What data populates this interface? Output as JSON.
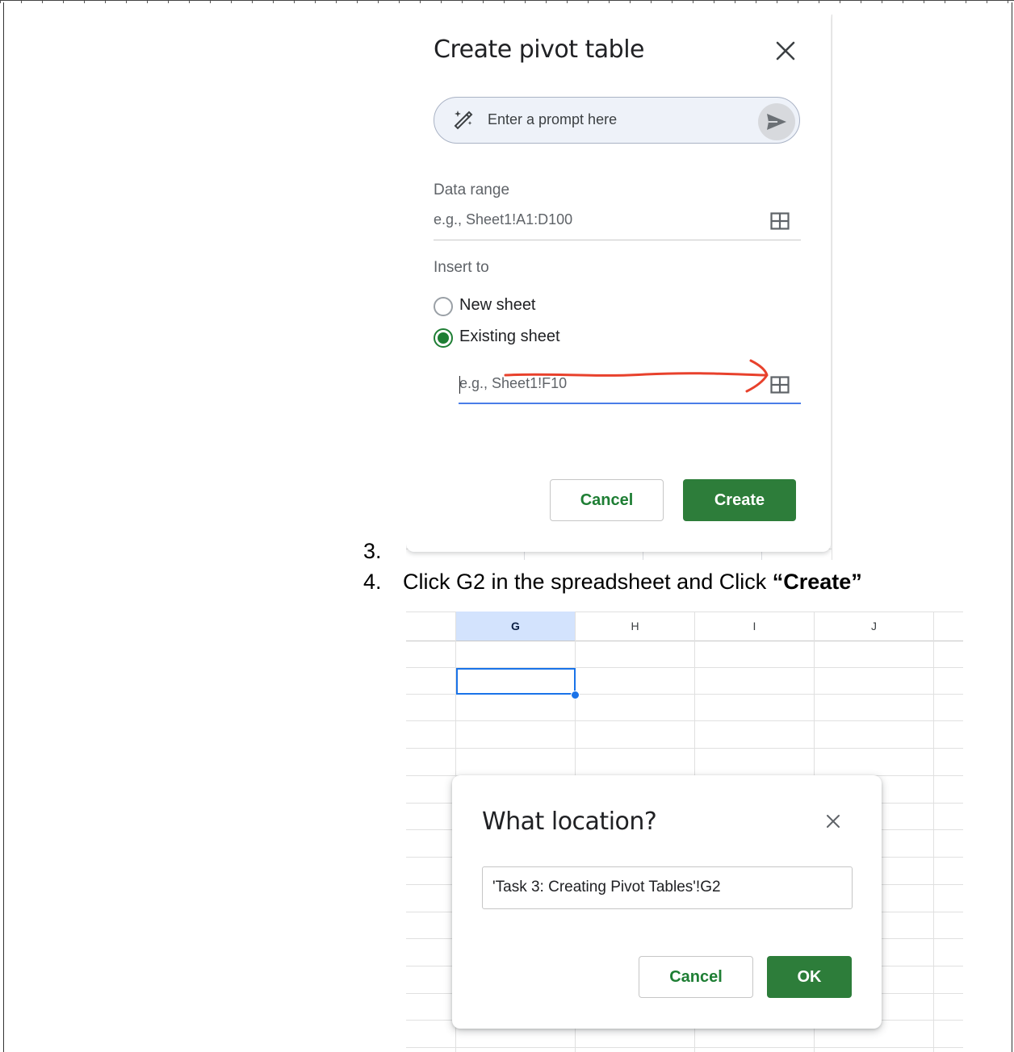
{
  "pivot_dialog": {
    "title": "Create pivot table",
    "prompt_placeholder": "Enter a prompt here",
    "data_range_label": "Data range",
    "data_range_placeholder": "e.g., Sheet1!A1:D100",
    "insert_to_label": "Insert to",
    "options": [
      {
        "label": "New sheet",
        "checked": false
      },
      {
        "label": "Existing sheet",
        "checked": true
      }
    ],
    "location_placeholder": "e.g., Sheet1!F10",
    "cancel_label": "Cancel",
    "create_label": "Create",
    "accent_color": "#2d7d3a",
    "annotation_color": "#e8412c"
  },
  "steps": {
    "step3_number": "3.",
    "step4_number": "4.",
    "step4_text": "Click G2 in the spreadsheet and Click ",
    "step4_bold": "“Create”"
  },
  "sheet": {
    "columns": [
      "G",
      "H",
      "I",
      "J"
    ],
    "selected_column": "G",
    "selected_cell": "G2",
    "selection_color": "#1a73e8"
  },
  "location_dialog": {
    "title": "What location?",
    "input_value": "'Task 3: Creating Pivot Tables'!G2",
    "cancel_label": "Cancel",
    "ok_label": "OK"
  }
}
